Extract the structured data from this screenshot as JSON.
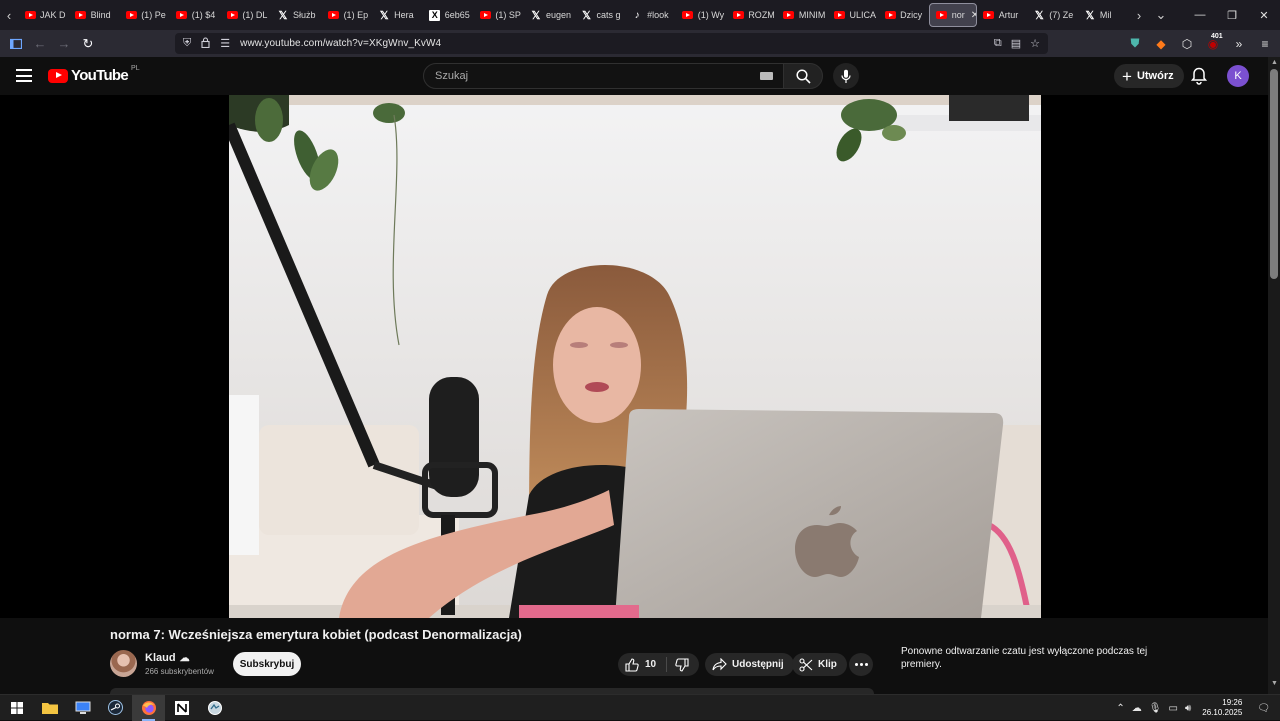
{
  "browser": {
    "tabs": [
      {
        "icon": "youtube-icon",
        "label": "JAK D"
      },
      {
        "icon": "youtube-icon",
        "label": "Blind"
      },
      {
        "icon": "youtube-icon",
        "label": "(1) Pe"
      },
      {
        "icon": "youtube-icon",
        "label": "(1) $4"
      },
      {
        "icon": "youtube-icon",
        "label": "(1) DL"
      },
      {
        "icon": "x-icon",
        "label": "Służb"
      },
      {
        "icon": "youtube-icon",
        "label": "(1) Ep"
      },
      {
        "icon": "x-icon",
        "label": "Hera"
      },
      {
        "icon": "x-box-icon",
        "label": "6eb65"
      },
      {
        "icon": "youtube-icon",
        "label": "(1) SP"
      },
      {
        "icon": "x-icon",
        "label": "eugen"
      },
      {
        "icon": "x-icon",
        "label": "cats g"
      },
      {
        "icon": "tiktok-icon",
        "label": "#look"
      },
      {
        "icon": "youtube-icon",
        "label": "(1) Wy"
      },
      {
        "icon": "youtube-icon",
        "label": "ROZM"
      },
      {
        "icon": "youtube-icon",
        "label": "MINIM"
      },
      {
        "icon": "youtube-icon",
        "label": "ULICA"
      },
      {
        "icon": "youtube-icon",
        "label": "Dzicy"
      },
      {
        "icon": "youtube-icon",
        "label": "nor",
        "active": true
      },
      {
        "icon": "youtube-icon",
        "label": "Artur"
      },
      {
        "icon": "x-icon",
        "label": "(7) Ze"
      },
      {
        "icon": "x-icon",
        "label": "Mil"
      }
    ],
    "url": "www.youtube.com/watch?v=XKgWnv_KvW4",
    "extension_badge": "401"
  },
  "youtube": {
    "logo_text": "YouTube",
    "country_code": "PL",
    "search_placeholder": "Szukaj",
    "create_label": "Utwórz",
    "avatar_letter": "K",
    "avatar_color": "#7b50d0"
  },
  "video": {
    "title": "norma 7: Wcześniejsza emerytura kobiet (podcast Denormalizacja)",
    "channel_name": "Klaud",
    "subscribers": "266 subskrybentów",
    "subscribe_label": "Subskrybuj",
    "likes": "10",
    "share_label": "Udostępnij",
    "clip_label": "Klip"
  },
  "chat": {
    "message": "Ponowne odtwarzanie czatu jest wyłączone podczas tej premiery."
  },
  "taskbar": {
    "time": "19:26",
    "date": "26.10.2025"
  }
}
